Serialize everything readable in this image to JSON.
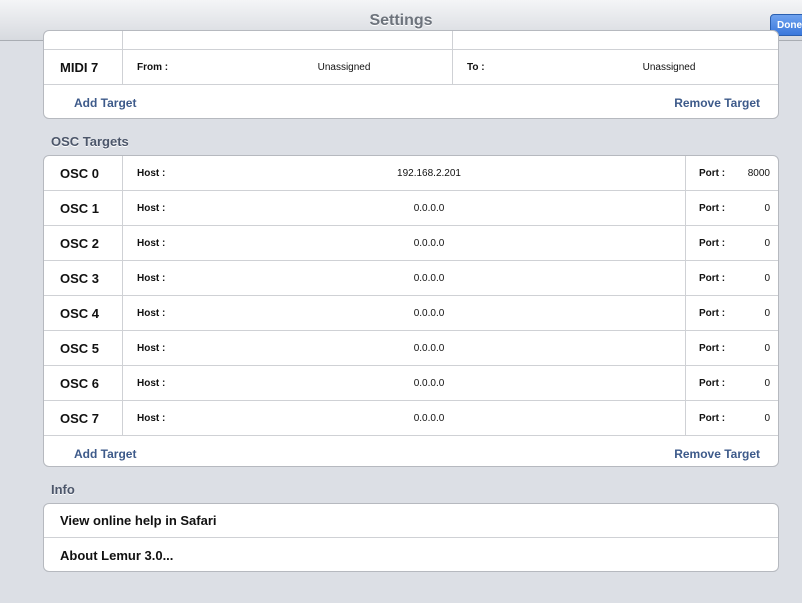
{
  "navbar": {
    "title": "Settings",
    "done_label": "Done"
  },
  "midi": {
    "row": {
      "name": "MIDI 7",
      "from_label": "From :",
      "from_value": "Unassigned",
      "to_label": "To :",
      "to_value": "Unassigned"
    },
    "add_label": "Add Target",
    "remove_label": "Remove Target"
  },
  "osc": {
    "header": "OSC Targets",
    "host_label": "Host :",
    "port_label": "Port :",
    "rows": [
      {
        "name": "OSC 0",
        "host": "192.168.2.201",
        "port": "8000"
      },
      {
        "name": "OSC 1",
        "host": "0.0.0.0",
        "port": "0"
      },
      {
        "name": "OSC 2",
        "host": "0.0.0.0",
        "port": "0"
      },
      {
        "name": "OSC 3",
        "host": "0.0.0.0",
        "port": "0"
      },
      {
        "name": "OSC 4",
        "host": "0.0.0.0",
        "port": "0"
      },
      {
        "name": "OSC 5",
        "host": "0.0.0.0",
        "port": "0"
      },
      {
        "name": "OSC 6",
        "host": "0.0.0.0",
        "port": "0"
      },
      {
        "name": "OSC 7",
        "host": "0.0.0.0",
        "port": "0"
      }
    ],
    "add_label": "Add Target",
    "remove_label": "Remove Target"
  },
  "info": {
    "header": "Info",
    "items": [
      {
        "label": "View online help in Safari"
      },
      {
        "label": "About Lemur 3.0..."
      }
    ]
  }
}
